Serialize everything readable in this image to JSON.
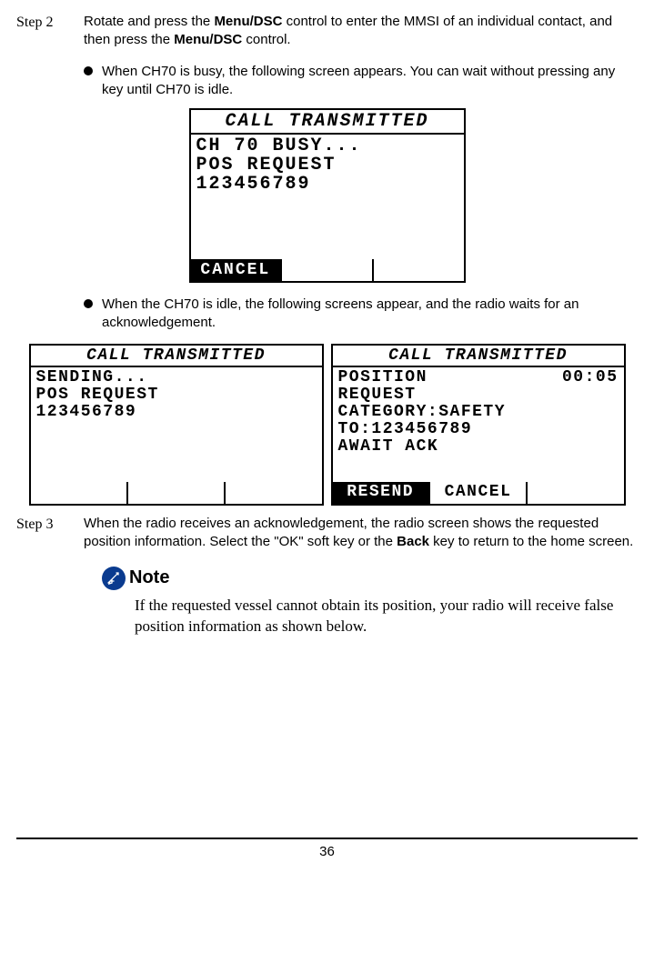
{
  "step2": {
    "label": "Step 2",
    "text_a": "Rotate and press the ",
    "bold_a": "Menu/DSC",
    "text_b": " control to enter the MMSI of an individual contact, and then press the ",
    "bold_b": "Menu/DSC",
    "text_c": " control."
  },
  "bullet1": "When CH70 is busy, the following screen appears. You can wait without pressing any key until CH70 is idle.",
  "lcd1": {
    "title": "CALL TRANSMITTED",
    "line1": "CH 70 BUSY...",
    "line2": "POS REQUEST",
    "line3": "123456789",
    "sk1": "CANCEL",
    "sk2": "",
    "sk3": ""
  },
  "bullet2": "When the CH70 is idle, the following screens appear, and the radio waits for an acknowledgement.",
  "lcd2": {
    "title": "CALL TRANSMITTED",
    "line1": "SENDING...",
    "line2": "POS REQUEST",
    "line3": "123456789",
    "sk1": "",
    "sk2": "",
    "sk3": ""
  },
  "lcd3": {
    "title": "CALL TRANSMITTED",
    "row1_left": "POSITION",
    "row1_right": "00:05",
    "line2": "REQUEST",
    "line3": "CATEGORY:SAFETY",
    "line4": "TO:123456789",
    "line5": "AWAIT ACK",
    "sk1": "RESEND",
    "sk2": "CANCEL",
    "sk3": ""
  },
  "step3": {
    "label": "Step 3",
    "text_a": "When the radio receives an acknowledgement, the radio screen shows the requested position information. Select the \"OK\" soft key or the ",
    "bold_a": "Back",
    "text_b": " key to return to the home screen."
  },
  "note": {
    "label": "Note",
    "body": "If the requested vessel cannot obtain its position, your radio will receive false position information as shown below."
  },
  "page_number": "36"
}
